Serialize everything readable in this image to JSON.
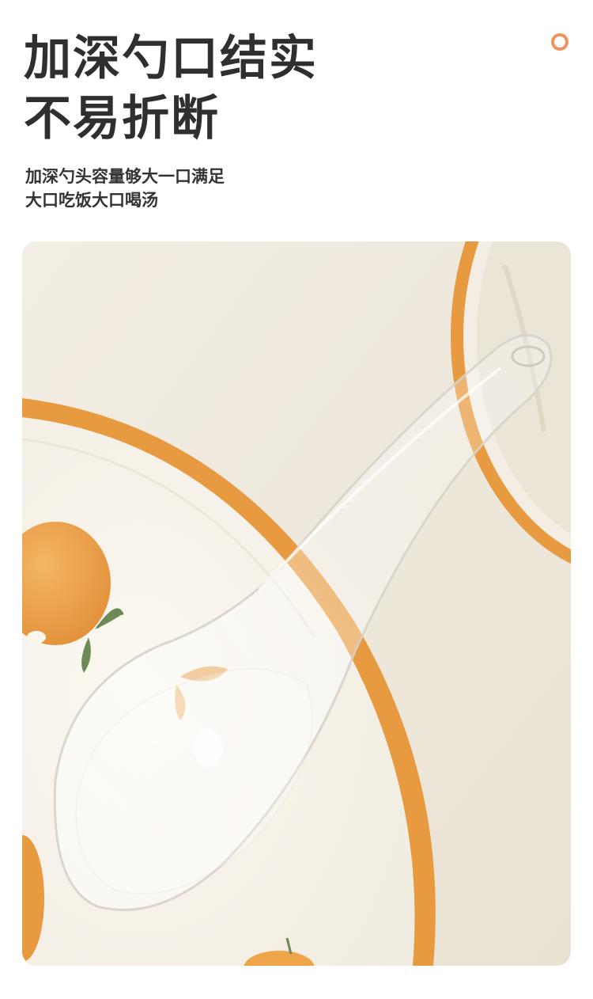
{
  "headline": {
    "line1": "加深勺口结实",
    "line2": "不易折断"
  },
  "description": {
    "line1": "加深勺头容量够大一口满足",
    "line2": "大口吃饭大口喝汤"
  },
  "colors": {
    "accent": "#f0915e",
    "plate_rim": "#e79a3f",
    "orange_fruit": "#eea54a",
    "leaf": "#6d8a56",
    "background": "#efe9dc"
  },
  "icons": {
    "corner_decoration": "ring-icon"
  },
  "photo": {
    "subject": "transparent-plastic-spoon-on-orange-pattern-plate"
  }
}
